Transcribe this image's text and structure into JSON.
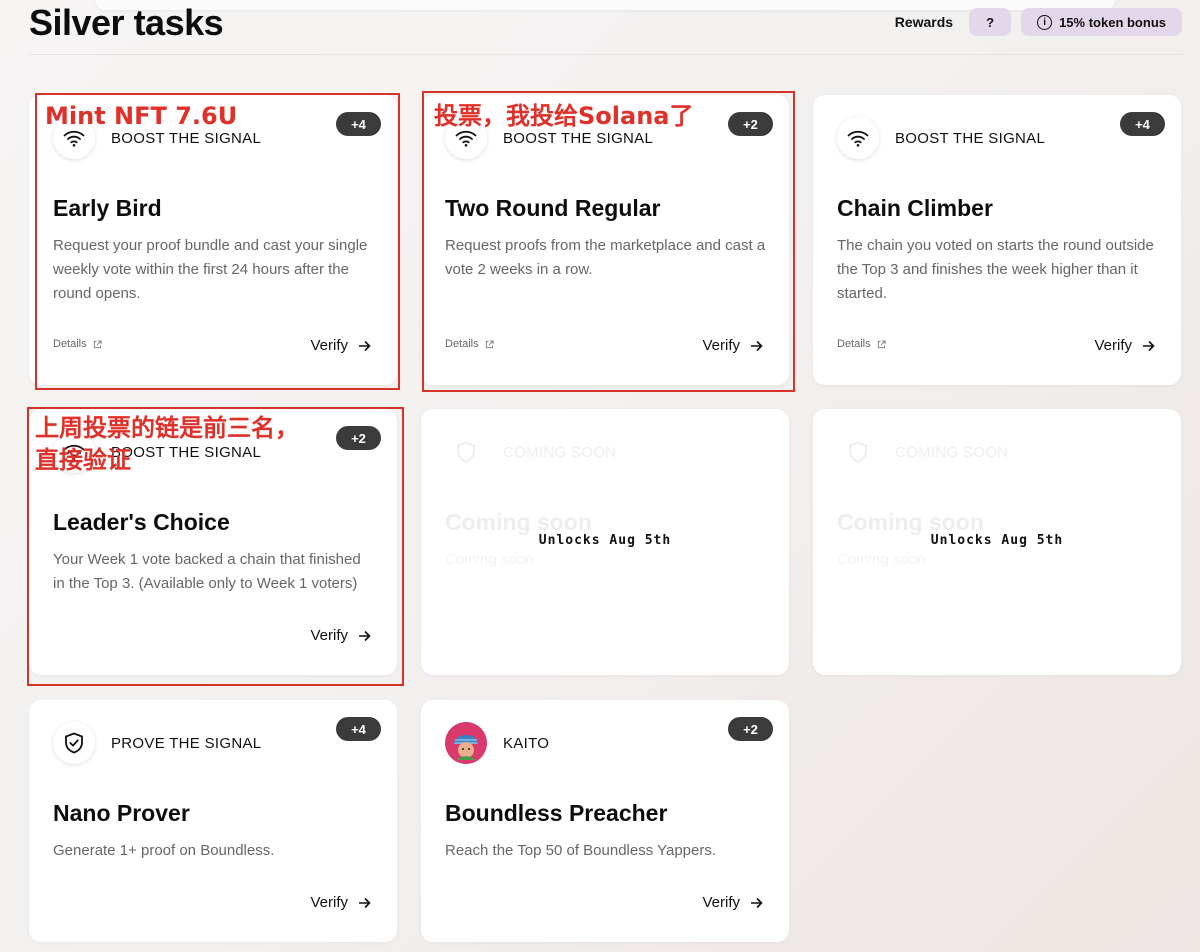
{
  "header": {
    "title": "Silver tasks",
    "rewards_label": "Rewards",
    "help_label": "?",
    "bonus_label": "15% token bonus",
    "info_glyph": "i"
  },
  "cards": [
    {
      "category": "BOOST THE SIGNAL",
      "icon": "wifi-icon",
      "points": "+4",
      "title": "Early Bird",
      "description": "Request your proof bundle and cast your single weekly vote within the first 24 hours after the round opens.",
      "details_label": "Details",
      "verify_label": "Verify"
    },
    {
      "category": "BOOST THE SIGNAL",
      "icon": "wifi-icon",
      "points": "+2",
      "title": "Two Round Regular",
      "description": "Request proofs from the marketplace and cast a vote 2 weeks in a row.",
      "details_label": "Details",
      "verify_label": "Verify"
    },
    {
      "category": "BOOST THE SIGNAL",
      "icon": "wifi-icon",
      "points": "+4",
      "title": "Chain Climber",
      "description": "The chain you voted on starts the round outside the Top 3 and finishes the week higher than it started.",
      "details_label": "Details",
      "verify_label": "Verify"
    },
    {
      "category": "BOOST THE SIGNAL",
      "icon": "wifi-icon",
      "points": "+2",
      "title": "Leader's Choice",
      "description": "Your Week 1 vote backed a chain that finished in the Top 3. (Available only to Week 1 voters)",
      "verify_label": "Verify"
    },
    {
      "locked": true,
      "category": "COMING SOON",
      "icon": "shield-icon",
      "title": "Coming soon",
      "description": "Coming soon",
      "unlock_label": "Unlocks Aug 5th"
    },
    {
      "locked": true,
      "category": "COMING SOON",
      "icon": "shield-icon",
      "title": "Coming soon",
      "description": "Coming soon",
      "unlock_label": "Unlocks Aug 5th"
    },
    {
      "category": "PROVE THE SIGNAL",
      "icon": "shield-check-icon",
      "points": "+4",
      "title": "Nano Prover",
      "description": "Generate 1+ proof on Boundless.",
      "verify_label": "Verify"
    },
    {
      "category": "KAITO",
      "icon": "kaito-avatar",
      "points": "+2",
      "title": "Boundless Preacher",
      "description": "Reach the Top 50 of Boundless Yappers.",
      "verify_label": "Verify"
    }
  ],
  "annotations": {
    "early_bird": "Mint NFT 7.6U",
    "two_round": "投票，我投给Solana了",
    "leaders_choice_line1": "上周投票的链是前三名，",
    "leaders_choice_line2": "直接验证"
  },
  "colors": {
    "annotation_red": "#d6342a",
    "badge_bg": "#3b3b3b",
    "button_purple": "#e3d7ea"
  }
}
